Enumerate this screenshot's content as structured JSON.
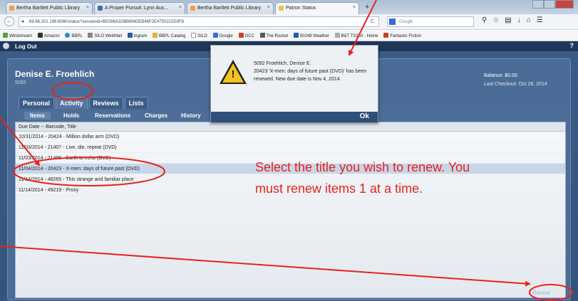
{
  "browser": {
    "tabs": [
      {
        "label": "Bertha Bartlett Public Library"
      },
      {
        "label": "A Proper Pursuit: Lynn Aus..."
      },
      {
        "label": "Bertha Bartlett Public Library"
      },
      {
        "label": "Patron Status"
      }
    ],
    "new_tab": "+",
    "url": "69.66.201.196:8080/status?sessionid=BE086A328B894DEB46F2E4750222D3F8",
    "search_placeholder": "Google",
    "bookmarks": [
      "Windstream",
      "Amazon",
      "BBPL",
      "SILO WebMail",
      "Ingram",
      "BBPL Catalog",
      "SILO",
      "Google",
      "GCC",
      "The Rocket",
      "50248 Weather",
      "B&T TS360 - Home",
      "Fantastic Fiction"
    ]
  },
  "app": {
    "topbar": {
      "logout": "Log Out",
      "help": "?"
    },
    "patron": {
      "name": "Denise E. Froehlich",
      "id": "5092",
      "balance": "Balance: $0.00",
      "last_checkout": "Last Checkout: Oct 28, 2014"
    },
    "tabs": [
      "Personal",
      "Activity",
      "Reviews",
      "Lists"
    ],
    "subtabs": [
      "Items",
      "Holds",
      "Reservations",
      "Charges",
      "History"
    ],
    "grid_header": "Due Date -- Barcode, Title",
    "items": [
      "10/31/2014 - 20424 - Million dollar arm (DVD)",
      "11/03/2014 - 21407 - Live, die, repeat (DVD)",
      "11/03/2014 - 21496 - Earth to echo (DVD)",
      "11/04/2014 - 20423 - X-men: days of future past (DVD)",
      "11/14/2014 - 48265 - This strange and familiar place",
      "11/14/2014 - 49219 - Proxy"
    ],
    "renew": "Renew"
  },
  "dialog": {
    "line1": "5092 Froehlich, Denise E.",
    "line2": "20423 'X-men: days of future past (DVD)' has been renewed. New due date is Nov 4, 2014.",
    "ok": "Ok"
  },
  "annotation": {
    "text": "Select the title you wish to renew. You must renew items 1 at a time.",
    "color": "#e8231d"
  }
}
